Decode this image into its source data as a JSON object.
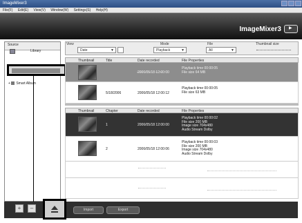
{
  "window": {
    "title": "ImageMixer3"
  },
  "menu": [
    "File(F)",
    "Edit(E)",
    "View(V)",
    "Window(W)",
    "Settings(S)",
    "Help(H)"
  ],
  "brand": {
    "name": "ImageMixer3",
    "badge": "▶"
  },
  "left_panel": {
    "header": "Source",
    "library_label": "Library",
    "smart_album": "Smart Album"
  },
  "filters": {
    "view_label": "View",
    "view_value": "Date",
    "mode_label": "Mode",
    "mode_value": "Playback",
    "file_label": "File",
    "file_value": "All",
    "thumb_label": "Thumbnail size"
  },
  "table_header": {
    "thumbnail": "Thumbnail",
    "title": "Title",
    "date": "Date recorded",
    "props": "File Properties"
  },
  "table_header2": {
    "thumbnail": "Thumbnail",
    "chapter": "Chapter",
    "date": "Date recorded",
    "props": "File Properties"
  },
  "rows_top": [
    {
      "title": "",
      "date": "2006/05/18 12:00:00",
      "props": [
        "Playback time 00:00:05",
        "File size 64 MB"
      ]
    },
    {
      "title": "5/18/2006",
      "date": "2006/05/18 12:00:12",
      "props": [
        "Playback time 00:00:05",
        "File size 63 MB"
      ]
    }
  ],
  "rows_bottom": [
    {
      "chapter": "1",
      "date": "2006/05/18 12:00:00",
      "props": [
        "Playback time 00:00:02",
        "File size 200 MB",
        "Image size 704x480",
        "Audio Stream Dolby"
      ]
    },
    {
      "chapter": "2",
      "date": "2006/05/18 12:00:06",
      "props": [
        "Playback time 00:00:03",
        "File size 200 MB",
        "Image size 704x480",
        "Audio Stream Dolby"
      ]
    }
  ],
  "buttons": {
    "add": "+",
    "remove": "–",
    "import": "Import",
    "export": "Export"
  }
}
